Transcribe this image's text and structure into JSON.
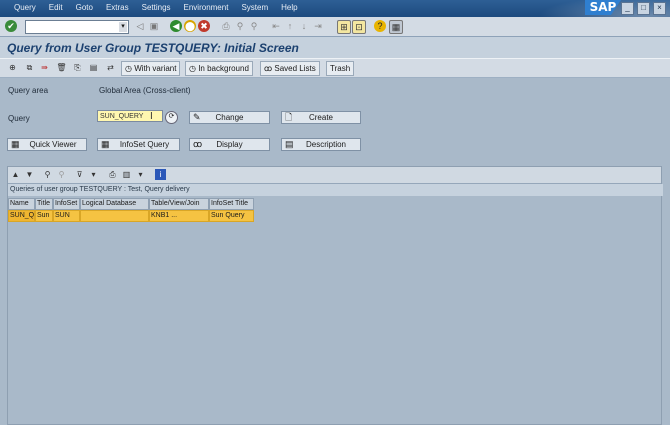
{
  "menu": [
    "Query",
    "Edit",
    "Goto",
    "Extras",
    "Settings",
    "Environment",
    "System",
    "Help"
  ],
  "window_buttons": [
    "_",
    "□",
    "×"
  ],
  "brand": "SAP",
  "command_field": {
    "value": ""
  },
  "page_title": "Query from User Group TESTQUERY: Initial Screen",
  "app_toolbar": {
    "with_variant": "With variant",
    "in_background": "In background",
    "saved_lists": "Saved Lists",
    "trash": "Trash"
  },
  "form": {
    "query_area_label": "Query area",
    "query_area_value": "Global Area (Cross-client)",
    "query_label": "Query",
    "query_value": "SUN_QUERY"
  },
  "buttons": {
    "change": "Change",
    "create": "Create",
    "quick_viewer": "Quick Viewer",
    "infoset_query": "InfoSet Query",
    "display": "Display",
    "description": "Description"
  },
  "list": {
    "title": "Queries of user group TESTQUERY : Test, Query delivery",
    "columns": [
      "Name",
      "Title",
      "InfoSet",
      "Logical Database",
      "Table/View/Join",
      "InfoSet Title"
    ],
    "rows": [
      [
        "SUN_QUERY",
        "Sun",
        "SUN",
        "",
        "KNB1 ...",
        "Sun Query"
      ]
    ]
  },
  "colors": {
    "menubar": "#1d4a7e",
    "title_text": "#1c4170",
    "selected_row": "#f5c342",
    "input_required": "#fff7b0"
  }
}
